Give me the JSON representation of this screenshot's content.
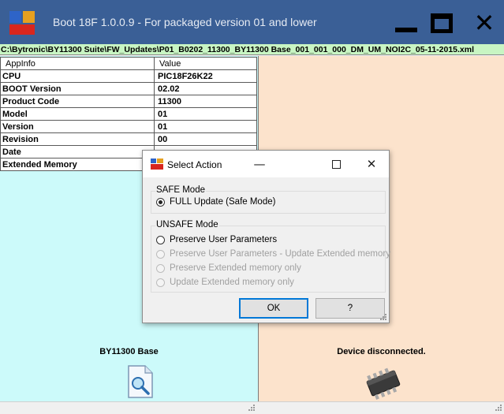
{
  "window": {
    "title": "Boot 18F 1.0.0.9 - For packaged version 01 and lower",
    "path": "C:\\Bytronic\\BY11300 Suite\\FW_Updates\\P01_B0202_11300_BY11300 Base_001_001_000_DM_UM_NOI2C_05-11-2015.xml"
  },
  "info_table": {
    "headers": [
      "AppInfo",
      "Value"
    ],
    "rows": [
      {
        "key": "CPU",
        "value": "PIC18F26K22"
      },
      {
        "key": "BOOT Version",
        "value": "02.02"
      },
      {
        "key": "Product Code",
        "value": "11300"
      },
      {
        "key": "Model",
        "value": "01"
      },
      {
        "key": "Version",
        "value": "01"
      },
      {
        "key": "Revision",
        "value": "00"
      },
      {
        "key": "Date",
        "value": ""
      },
      {
        "key": "Extended Memory",
        "value": ""
      }
    ]
  },
  "left_panel": {
    "caption": "BY11300 Base",
    "icon": "document-search-icon"
  },
  "right_panel": {
    "caption": "Device disconnected.",
    "icon": "chip-icon"
  },
  "dialog": {
    "title": "Select Action",
    "minimize_glyph": "—",
    "close_glyph": "✕",
    "safe_group_label": "SAFE Mode",
    "safe_options": [
      {
        "label": "FULL Update (Safe Mode)",
        "checked": true,
        "enabled": true
      }
    ],
    "unsafe_group_label": "UNSAFE Mode",
    "unsafe_options": [
      {
        "label": "Preserve User Parameters",
        "checked": false,
        "enabled": true
      },
      {
        "label": "Preserve User Parameters - Update Extended memory",
        "checked": false,
        "enabled": false
      },
      {
        "label": "Preserve Extended memory only",
        "checked": false,
        "enabled": false
      },
      {
        "label": "Update Extended memory only",
        "checked": false,
        "enabled": false
      }
    ],
    "ok_label": "OK",
    "help_label": "?"
  },
  "colors": {
    "titlebar": "#3a5f96",
    "pathbar": "#c8f5c3",
    "left_panel": "#ccfafa",
    "right_panel": "#fce3cc",
    "default_button_border": "#0078d7"
  }
}
